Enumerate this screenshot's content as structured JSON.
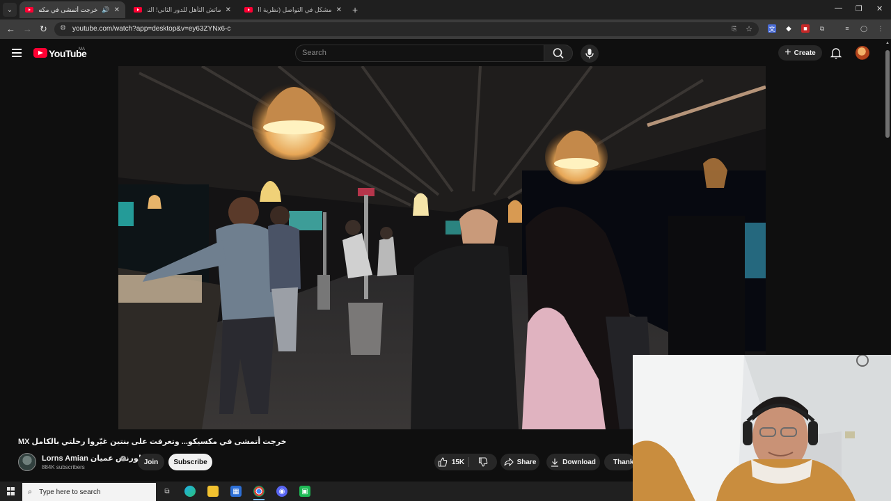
{
  "browser": {
    "tabs": [
      {
        "title": "خرجت أتمشى في مكسيكو...",
        "active": true,
        "audio": true
      },
      {
        "title": "ماتش التأهل للدور الثاني! التشكيل",
        "active": false
      },
      {
        "title": "مشكل في التواصل (نظرية البرازك...",
        "active": false
      }
    ],
    "url": "youtube.com/watch?app=desktop&v=ey63ZYNx6-c"
  },
  "youtube": {
    "logo_text": "YouTube",
    "country_code": "MA",
    "search_placeholder": "Search",
    "create_label": "Create"
  },
  "video": {
    "title": "خرجت أتمشى في مكسيكو... وتعرفت على بنتين غيّروا رحلتي بالكامل MX",
    "channel_name": "Lorns Amian لورنس عميان",
    "subscribers": "884K subscribers",
    "join_label": "Join",
    "subscribe_label": "Subscribe",
    "likes": "15K",
    "share_label": "Share",
    "download_label": "Download",
    "thanks_label": "Thanks"
  },
  "taskbar": {
    "search_placeholder": "Type here to search"
  },
  "colors": {
    "yt_red": "#ff0033",
    "background": "#0f0f0f",
    "chip": "#272727"
  }
}
